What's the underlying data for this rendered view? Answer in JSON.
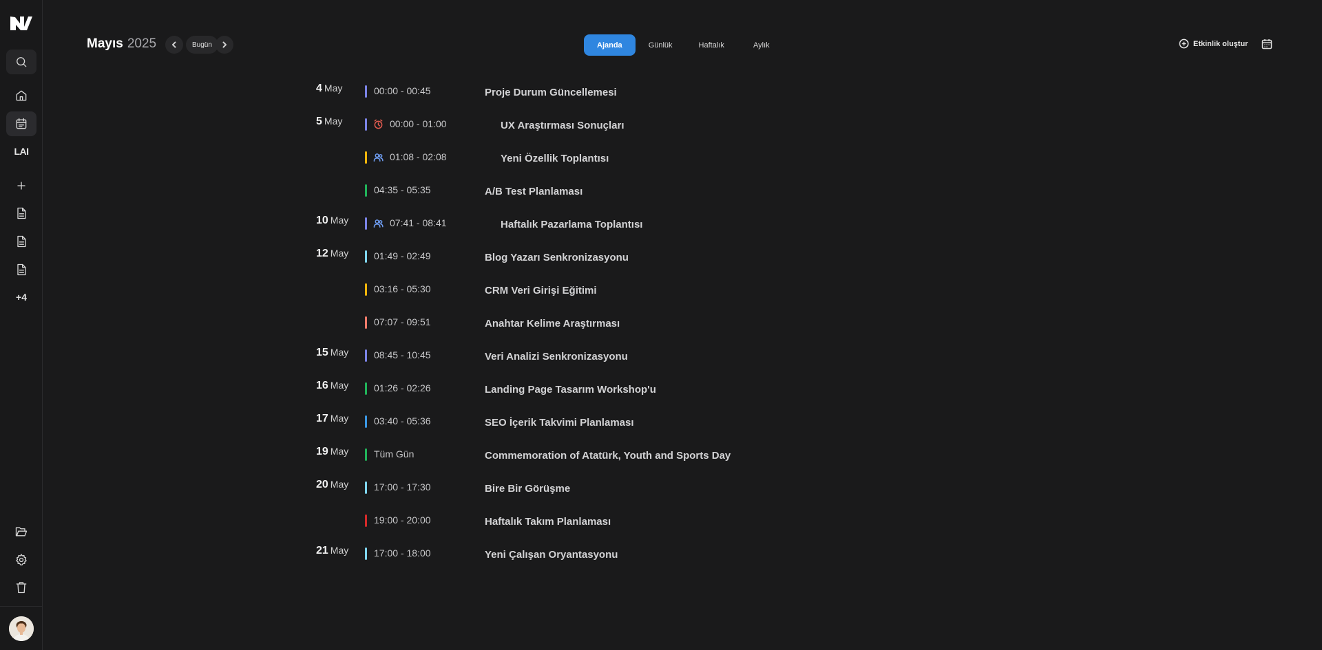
{
  "header": {
    "month": "Mayıs",
    "year": "2025",
    "today_label": "Bugün",
    "create_label": "Etkinlik oluştur"
  },
  "view_tabs": [
    {
      "label": "Ajanda",
      "active": true
    },
    {
      "label": "Günlük",
      "active": false
    },
    {
      "label": "Haftalık",
      "active": false
    },
    {
      "label": "Aylık",
      "active": false
    }
  ],
  "sidebar": {
    "lai_label": "LAI",
    "more_label": "+4"
  },
  "colors": {
    "accent": "#2f86e0",
    "indigo": "#7b83e6",
    "yellow": "#f5b50a",
    "green": "#21b45a",
    "cyan": "#7fd6ef",
    "salmon": "#f07b6a",
    "blue": "#3b97e3",
    "red": "#d62a2a"
  },
  "agenda": [
    {
      "day": "4",
      "month": "May",
      "events": [
        {
          "time": "00:00 - 00:45",
          "title": "Proje Durum Güncellemesi",
          "color": "#7b83e6",
          "icon": ""
        }
      ]
    },
    {
      "day": "5",
      "month": "May",
      "events": [
        {
          "time": "00:00 - 01:00",
          "title": "UX Araştırması Sonuçları",
          "color": "#7b83e6",
          "icon": "alarm-icon"
        },
        {
          "time": "01:08 - 02:08",
          "title": "Yeni Özellik Toplantısı",
          "color": "#f5b50a",
          "icon": "users-icon"
        },
        {
          "time": "04:35 - 05:35",
          "title": "A/B Test Planlaması",
          "color": "#21b45a",
          "icon": ""
        }
      ]
    },
    {
      "day": "10",
      "month": "May",
      "events": [
        {
          "time": "07:41 - 08:41",
          "title": "Haftalık Pazarlama Toplantısı",
          "color": "#7b83e6",
          "icon": "users-icon"
        }
      ]
    },
    {
      "day": "12",
      "month": "May",
      "events": [
        {
          "time": "01:49 - 02:49",
          "title": "Blog Yazarı Senkronizasyonu",
          "color": "#7fd6ef",
          "icon": ""
        },
        {
          "time": "03:16 - 05:30",
          "title": "CRM Veri Girişi Eğitimi",
          "color": "#f5b50a",
          "icon": ""
        },
        {
          "time": "07:07 - 09:51",
          "title": "Anahtar Kelime Araştırması",
          "color": "#f07b6a",
          "icon": ""
        }
      ]
    },
    {
      "day": "15",
      "month": "May",
      "events": [
        {
          "time": "08:45 - 10:45",
          "title": "Veri Analizi Senkronizasyonu",
          "color": "#7b83e6",
          "icon": ""
        }
      ]
    },
    {
      "day": "16",
      "month": "May",
      "events": [
        {
          "time": "01:26 - 02:26",
          "title": "Landing Page Tasarım Workshop'u",
          "color": "#21b45a",
          "icon": ""
        }
      ]
    },
    {
      "day": "17",
      "month": "May",
      "events": [
        {
          "time": "03:40 - 05:36",
          "title": "SEO İçerik Takvimi Planlaması",
          "color": "#3b97e3",
          "icon": ""
        }
      ]
    },
    {
      "day": "19",
      "month": "May",
      "events": [
        {
          "time": "Tüm Gün",
          "title": "Commemoration of Atatürk, Youth and Sports Day",
          "color": "#21b45a",
          "icon": ""
        }
      ]
    },
    {
      "day": "20",
      "month": "May",
      "events": [
        {
          "time": "17:00 - 17:30",
          "title": "Bire Bir Görüşme",
          "color": "#7fd6ef",
          "icon": ""
        },
        {
          "time": "19:00 - 20:00",
          "title": "Haftalık Takım Planlaması",
          "color": "#d62a2a",
          "icon": ""
        }
      ]
    },
    {
      "day": "21",
      "month": "May",
      "events": [
        {
          "time": "17:00 - 18:00",
          "title": "Yeni Çalışan Oryantasyonu",
          "color": "#7fd6ef",
          "icon": ""
        }
      ]
    }
  ]
}
